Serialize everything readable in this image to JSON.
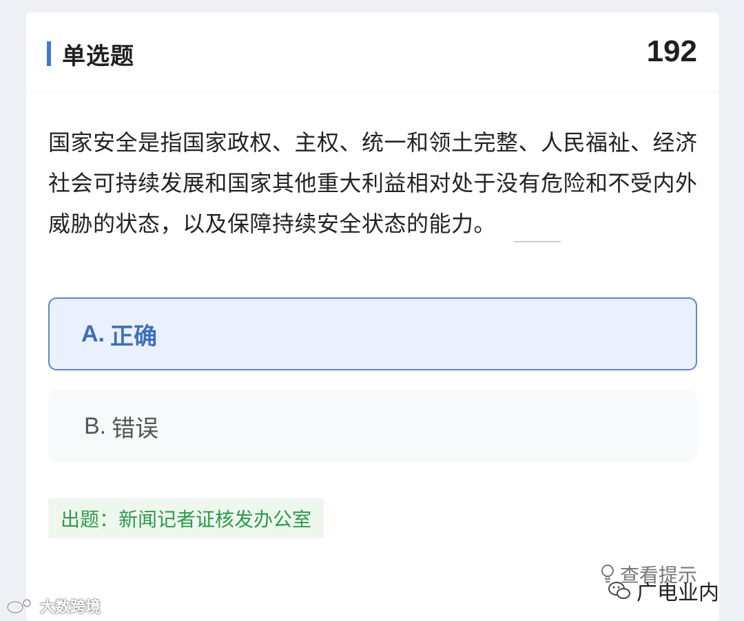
{
  "header": {
    "title": "单选题",
    "question_number": "192"
  },
  "question": {
    "text": "国家安全是指国家政权、主权、统一和领土完整、人民福祉、经济社会可持续发展和国家其他重大利益相对处于没有危险和不受内外威胁的状态，以及保障持续安全状态的能力。"
  },
  "options": [
    {
      "letter": "A.",
      "text": "正确",
      "selected": true
    },
    {
      "letter": "B.",
      "text": "错误",
      "selected": false
    }
  ],
  "source": {
    "text": "出题：新闻记者证核发办公室"
  },
  "hint": {
    "label": "查看提示",
    "icon": "lightbulb-icon"
  },
  "watermarks": {
    "left": "大数跨境",
    "right": "广电业内"
  },
  "colors": {
    "accent": "#3c78d8",
    "selected_bg": "#eaf0fd",
    "selected_border": "#5d86c8",
    "source_green": "#2f9a4a"
  }
}
